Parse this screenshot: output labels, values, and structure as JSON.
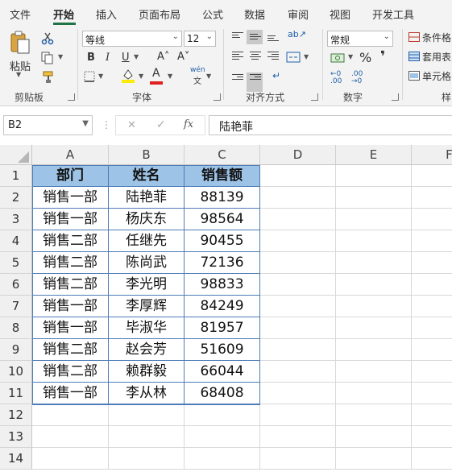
{
  "tabs": [
    "文件",
    "开始",
    "插入",
    "页面布局",
    "公式",
    "数据",
    "审阅",
    "视图",
    "开发工具"
  ],
  "active_tab": "开始",
  "ribbon": {
    "clipboard": {
      "paste_label": "粘贴",
      "group_label": "剪贴板"
    },
    "font": {
      "font_name": "等线",
      "font_size": "12",
      "bold": "B",
      "italic": "I",
      "underline": "U",
      "grow": "A˄",
      "shrink": "A˅",
      "pinyin": "wén",
      "font_color_glyph": "A",
      "group_label": "字体"
    },
    "alignment": {
      "group_label": "对齐方式"
    },
    "number": {
      "format": "常规",
      "percent": "%",
      "comma": "❜",
      "group_label": "数字"
    },
    "styles": {
      "conditional": "条件格",
      "as_table": "套用表",
      "cell_styles": "单元格",
      "group_label": "样"
    }
  },
  "formula_bar": {
    "name_box": "B2",
    "value": "陆艳菲",
    "cancel": "✕",
    "enter": "✓",
    "fx": "fx"
  },
  "columns": [
    "A",
    "B",
    "C",
    "D",
    "E",
    "F"
  ],
  "rows": [
    "1",
    "2",
    "3",
    "4",
    "5",
    "6",
    "7",
    "8",
    "9",
    "10",
    "11",
    "12",
    "13",
    "14"
  ],
  "table": {
    "headers": [
      "部门",
      "姓名",
      "销售额"
    ],
    "data": [
      [
        "销售一部",
        "陆艳菲",
        "88139"
      ],
      [
        "销售一部",
        "杨庆东",
        "98564"
      ],
      [
        "销售二部",
        "任继先",
        "90455"
      ],
      [
        "销售二部",
        "陈尚武",
        "72136"
      ],
      [
        "销售二部",
        "李光明",
        "98833"
      ],
      [
        "销售一部",
        "李厚辉",
        "84249"
      ],
      [
        "销售一部",
        "毕淑华",
        "81957"
      ],
      [
        "销售二部",
        "赵会芳",
        "51609"
      ],
      [
        "销售二部",
        "赖群毅",
        "66044"
      ],
      [
        "销售一部",
        "李从林",
        "68408"
      ]
    ]
  },
  "colors": {
    "accent": "#217346",
    "header_fill": "#9dc3e6",
    "table_border": "#4f7bb6",
    "font_color_bar": "#e02020",
    "highlight_bar": "#ffeb00"
  }
}
